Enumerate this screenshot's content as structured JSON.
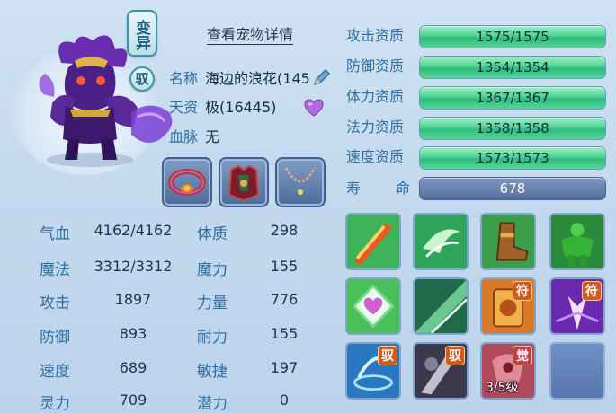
{
  "pet": {
    "variant_tag": "变异",
    "bind_tag": "驭",
    "detail_link": "查看宠物详情",
    "name_label": "名称",
    "name_value": "海边的浪花(145",
    "aptitude_label": "天资",
    "aptitude_value": "极(16445)",
    "bloodline_label": "血脉",
    "bloodline_value": "无"
  },
  "equipment": [
    {
      "icon": "collar-equipment-icon"
    },
    {
      "icon": "armor-equipment-icon"
    },
    {
      "icon": "necklace-equipment-icon"
    }
  ],
  "stats": [
    {
      "left_label": "气血",
      "left_value": "4162/4162",
      "right_label": "体质",
      "right_value": "298"
    },
    {
      "left_label": "魔法",
      "left_value": "3312/3312",
      "right_label": "魔力",
      "right_value": "155"
    },
    {
      "left_label": "攻击",
      "left_value": "1897",
      "right_label": "力量",
      "right_value": "776"
    },
    {
      "left_label": "防御",
      "left_value": "893",
      "right_label": "耐力",
      "right_value": "155"
    },
    {
      "left_label": "速度",
      "left_value": "689",
      "right_label": "敏捷",
      "right_value": "197"
    },
    {
      "left_label": "灵力",
      "left_value": "709",
      "right_label": "潜力",
      "right_value": "0"
    }
  ],
  "aptitudes": [
    {
      "label": "攻击资质",
      "value": "1575/1575"
    },
    {
      "label": "防御资质",
      "value": "1354/1354"
    },
    {
      "label": "体力资质",
      "value": "1367/1367"
    },
    {
      "label": "法力资质",
      "value": "1358/1358"
    },
    {
      "label": "速度资质",
      "value": "1573/1573"
    }
  ],
  "lifespan": {
    "label_a": "寿",
    "label_b": "命",
    "value": "678"
  },
  "skills": [
    {
      "icon": "sword-strike-skill-icon",
      "badge": ""
    },
    {
      "icon": "wind-blade-skill-icon",
      "badge": ""
    },
    {
      "icon": "boot-speed-skill-icon",
      "badge": ""
    },
    {
      "icon": "green-giant-skill-icon",
      "badge": ""
    },
    {
      "icon": "heart-shield-skill-icon",
      "badge": ""
    },
    {
      "icon": "light-burst-skill-icon",
      "badge": ""
    },
    {
      "icon": "lion-talisman-skill-icon",
      "badge": "符"
    },
    {
      "icon": "purple-burst-skill-icon",
      "badge": "符"
    },
    {
      "icon": "water-vortex-skill-icon",
      "badge": "驭"
    },
    {
      "icon": "shadow-strike-skill-icon",
      "badge": "驭"
    },
    {
      "icon": "red-awaken-skill-icon",
      "badge": "觉",
      "level": "3/5级"
    },
    {
      "icon": "empty-slot",
      "badge": ""
    }
  ],
  "colors": {
    "background": "#c4d9ee",
    "label_blue": "#2e6fa3",
    "bar_green": "#4fd393",
    "bar_blue": "#566f9d"
  }
}
